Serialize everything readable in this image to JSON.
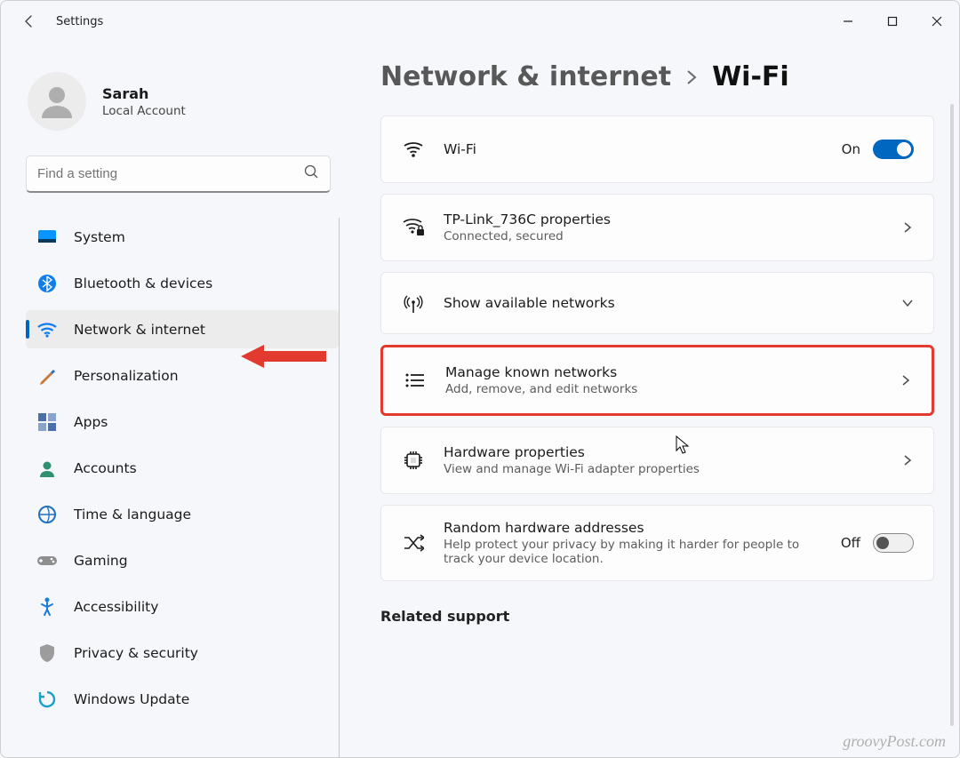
{
  "window": {
    "title": "Settings"
  },
  "profile": {
    "name": "Sarah",
    "account_type": "Local Account"
  },
  "search": {
    "placeholder": "Find a setting"
  },
  "sidebar": {
    "items": [
      {
        "label": "System"
      },
      {
        "label": "Bluetooth & devices"
      },
      {
        "label": "Network & internet"
      },
      {
        "label": "Personalization"
      },
      {
        "label": "Apps"
      },
      {
        "label": "Accounts"
      },
      {
        "label": "Time & language"
      },
      {
        "label": "Gaming"
      },
      {
        "label": "Accessibility"
      },
      {
        "label": "Privacy & security"
      },
      {
        "label": "Windows Update"
      }
    ],
    "active_index": 2
  },
  "breadcrumb": {
    "parent": "Network & internet",
    "current": "Wi-Fi"
  },
  "cards": {
    "wifi": {
      "title": "Wi-Fi",
      "state_label": "On",
      "on": true
    },
    "connection": {
      "title": "TP-Link_736C properties",
      "subtitle": "Connected, secured"
    },
    "available": {
      "title": "Show available networks"
    },
    "known": {
      "title": "Manage known networks",
      "subtitle": "Add, remove, and edit networks"
    },
    "hardware": {
      "title": "Hardware properties",
      "subtitle": "View and manage Wi-Fi adapter properties"
    },
    "random": {
      "title": "Random hardware addresses",
      "subtitle": "Help protect your privacy by making it harder for people to track your device location.",
      "state_label": "Off",
      "on": false
    }
  },
  "related_support_heading": "Related support",
  "watermark": "groovyPost.com",
  "colors": {
    "accent": "#0067c0",
    "highlight": "#e23a2e"
  }
}
